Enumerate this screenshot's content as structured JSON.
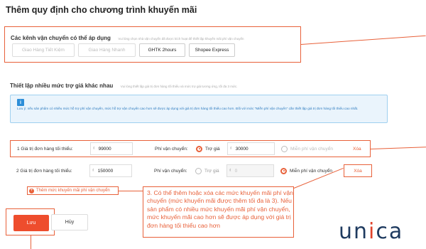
{
  "page": {
    "title": "Thêm quy định cho chương trình khuyến mãi"
  },
  "carriers": {
    "title": "Các kênh vận chuyển có thể áp dụng",
    "hint": "Vui lòng chọn nhà vận chuyển đã được kích hoạt để thiết lập khuyến mãi phí vận chuyển",
    "items": [
      {
        "label": "Giao Hàng Tiết Kiệm",
        "enabled": false
      },
      {
        "label": "Giao Hàng Nhanh",
        "enabled": false
      },
      {
        "label": "GHTK 2hours",
        "enabled": true
      },
      {
        "label": "Shopee Express",
        "enabled": true
      }
    ]
  },
  "tiers": {
    "title": "Thiết lập nhiều mức trợ giá khác nhau",
    "hint": "Vui lòng thiết lập giá trị đơn hàng tối thiểu và mức trợ giá tương ứng, tối đa 3 mức.",
    "info": "Lưu ý: nếu sản phẩm có nhiều mức hỗ trợ phí vận chuyển, mức hỗ trợ vận chuyển cao hơn sẽ được áp dụng với giá trị đơn hàng tối thiểu cao hơn. Đối với mức \"Miễn phí vận chuyển\" cần thiết lập giá trị đơn hàng tối thiểu cao nhất.",
    "info_icon": "info-icon",
    "currency": "₫",
    "shipping_label": "Phí vận chuyển:",
    "subsidy_label": "Trợ giá",
    "free_label": "Miễn phí vận chuyển",
    "delete_label": "Xóa",
    "rows": [
      {
        "label": "1  Giá trị đơn hàng tối thiểu:",
        "min_order": "99000",
        "subsidy": "30000",
        "selected": "subsidy"
      },
      {
        "label": "2  Giá trị đơn hàng tối thiểu:",
        "min_order": "150000",
        "subsidy": "0",
        "selected": "free"
      }
    ],
    "add_label": "Thêm mức khuyến mãi phí vận chuyển"
  },
  "annotation": {
    "lines": [
      "3. Có thể thêm hoặc xóa các mức khuyến mãi phí vận",
      "chuyển (mức khuyến mãi được thêm tối đa là 3). Nếu",
      "sản phẩm có nhiều mức khuyến mãi phí vận chuyển,",
      "mức khuyến mãi cao hơn sẽ được áp dụng với giá trị",
      "đơn hàng tối thiểu cao hơn"
    ]
  },
  "actions": {
    "save_label": "Lưu",
    "cancel_label": "Hủy"
  },
  "logo": {
    "part1": "un",
    "part2": "i",
    "part3": "ca"
  },
  "colors": {
    "accent": "#ee4d2d",
    "outline": "#e8613a",
    "info_bg": "#eaf4fc",
    "info_text": "#2d7bbf"
  }
}
